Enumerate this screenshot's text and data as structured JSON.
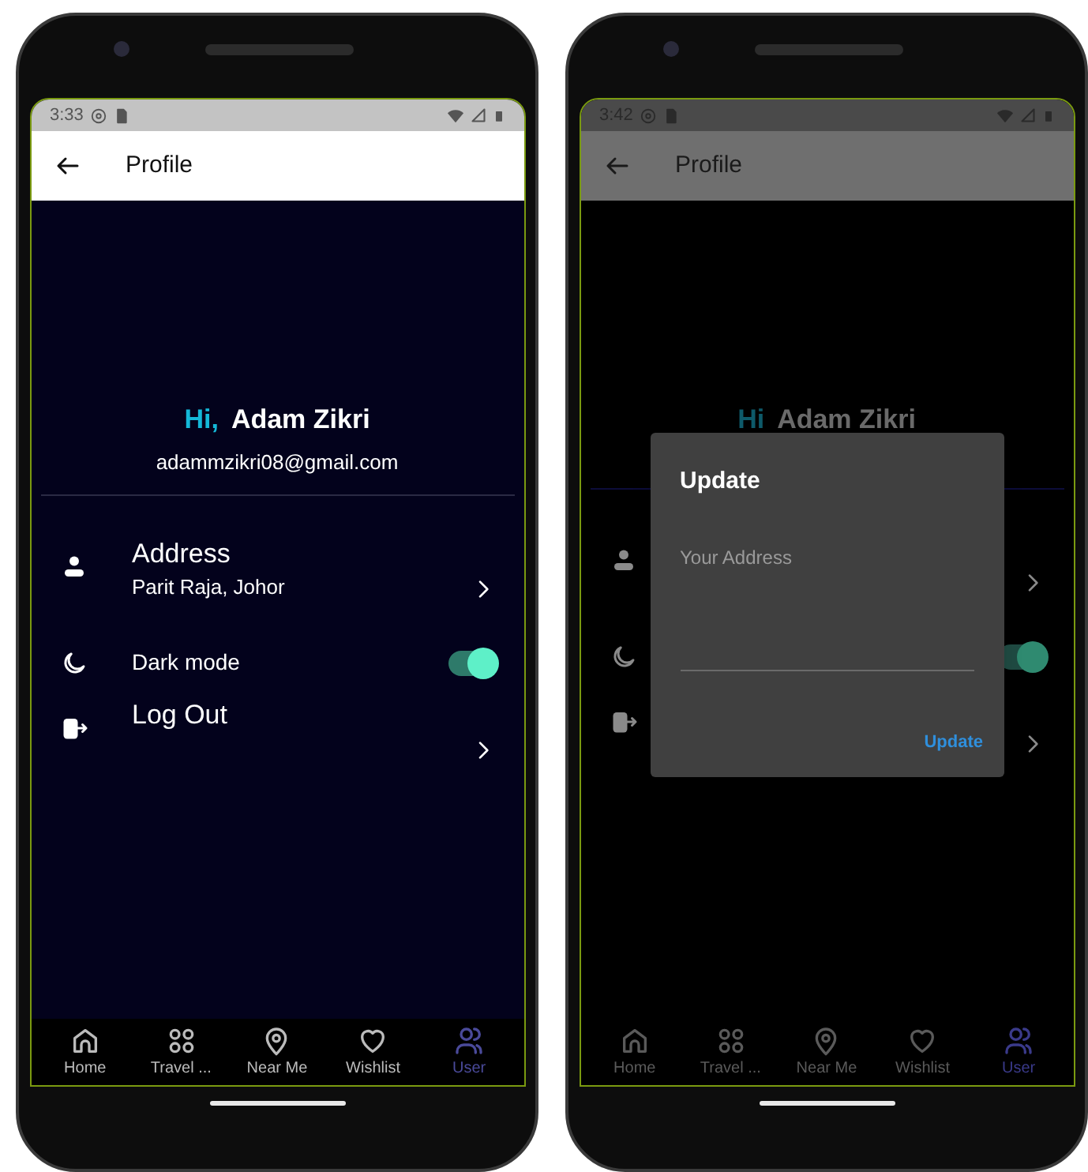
{
  "phones": [
    {
      "dimmed": false,
      "status_bar": {
        "time": "3:33"
      },
      "app_bar": {
        "title": "Profile"
      },
      "greeting": {
        "hi": "Hi,",
        "name": "Adam Zikri"
      },
      "email": "adammzikri08@gmail.com",
      "menu": [
        {
          "kind": "link",
          "title": "Address",
          "subtitle": "Parit Raja, Johor"
        },
        {
          "kind": "toggle",
          "title": "Dark mode",
          "on": true
        },
        {
          "kind": "link",
          "title": "Log Out"
        }
      ],
      "bottom_nav": [
        {
          "label": "Home",
          "selected": false
        },
        {
          "label": "Travel ...",
          "selected": false
        },
        {
          "label": "Near Me",
          "selected": false
        },
        {
          "label": "Wishlist",
          "selected": false
        },
        {
          "label": "User",
          "selected": true
        }
      ]
    },
    {
      "dimmed": true,
      "status_bar": {
        "time": "3:42"
      },
      "app_bar": {
        "title": "Profile"
      },
      "greeting": {
        "hi": "Hi",
        "name": "Adam Zikri"
      },
      "menu": [
        {
          "kind": "link"
        },
        {
          "kind": "toggle",
          "on": true
        },
        {
          "kind": "link"
        }
      ],
      "bottom_nav": [
        {
          "label": "Home",
          "selected": false
        },
        {
          "label": "Travel ...",
          "selected": false
        },
        {
          "label": "Near Me",
          "selected": false
        },
        {
          "label": "Wishlist",
          "selected": false
        },
        {
          "label": "User",
          "selected": true
        }
      ],
      "dialog": {
        "title": "Update",
        "field": {
          "placeholder": "Your Address"
        },
        "button": "Update"
      }
    }
  ]
}
